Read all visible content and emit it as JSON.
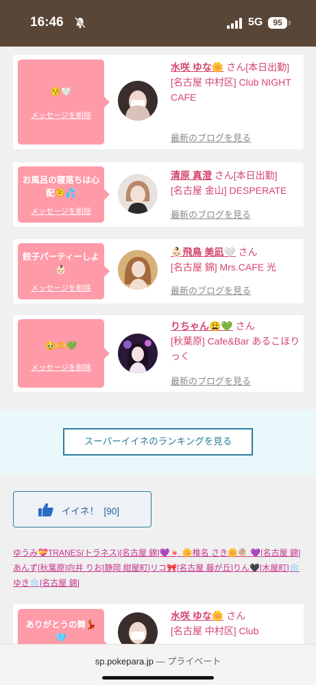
{
  "status": {
    "time": "16:46",
    "network": "5G",
    "battery": "95"
  },
  "cards": [
    {
      "message": "😚🤍",
      "delete_label": "メッセージを削除",
      "name": "水咲 ゆな🌼",
      "honorific": "さん",
      "badge": "[本日出勤]",
      "shop": "[名古屋 中村区] Club NIGHT CAFE",
      "blog_label": "最新のブログを見る"
    },
    {
      "message": "お風呂の寝落ちは心配🫠💦",
      "delete_label": "メッセージを削除",
      "name": "清原 真澄",
      "honorific": "さん",
      "badge": "[本日出勤]",
      "shop": "[名古屋 金山] DESPERATE",
      "blog_label": "最新のブログを見る"
    },
    {
      "message": "餃子パーティーしよ👶🏻",
      "delete_label": "メッセージを削除",
      "name": "👶🏻飛鳥 美凪🤍",
      "honorific": "さん",
      "badge": "",
      "shop": "[名古屋 錦] Mrs.CAFE 光",
      "blog_label": "最新のブログを見る"
    },
    {
      "message": "🥹🫶💚",
      "delete_label": "メッセージを削除",
      "name": "りちゃん😩💚",
      "honorific": "さん",
      "badge": "",
      "shop": "[秋葉原] Cafe&Bar あるこほりっく",
      "blog_label": "最新のブログを見る"
    },
    {
      "message": "ありがとうの舞💃🩵",
      "delete_label": "メッセージを削除",
      "name": "水咲 ゆな🌼",
      "honorific": "さん",
      "badge": "",
      "shop": "[名古屋 中村区] Club",
      "blog_label": ""
    }
  ],
  "ranking_button": "スーパーイイネのランキングを見る",
  "like": {
    "label": "イイネ！",
    "count": "[90]"
  },
  "likers_text": "ゆうみ💝TRANES(トラネス)[名古屋 錦]💜🍬 🌼椎名 さき🌼🍭 💜[名古屋 錦]あんず[秋葉原]向井 りお[静岡 紺屋町]リコ🎀[名古屋 藤が丘]りん🖤[木屋町]❄️ゆき❄️[名古屋 錦]",
  "browser": {
    "url": "sp.pokepara.jp",
    "private": " — プライベート"
  },
  "colors": {
    "status_bar": "#5a4636",
    "bubble": "#ff9aa8",
    "accent": "#d4446c",
    "button_border": "#2a7a9c"
  }
}
